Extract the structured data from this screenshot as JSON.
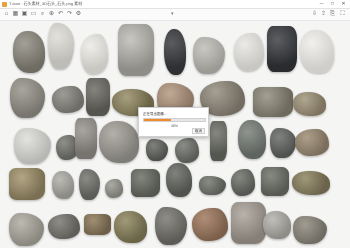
{
  "window": {
    "title": "T-Icon · 石头素材_3D石头_石头.png 素材"
  },
  "toolbar": {
    "icons": [
      "home-icon",
      "grid-icon",
      "image-icon",
      "folder-icon",
      "search-icon",
      "zoom-icon",
      "undo-icon",
      "redo-icon",
      "settings-icon"
    ],
    "right_icons": [
      "download-icon",
      "share-icon",
      "export-icon",
      "fullscreen-icon"
    ]
  },
  "dialog": {
    "message": "正在导出图像…",
    "progress_percent": 45,
    "percent_label": "45%",
    "cancel_label": "取消"
  },
  "colors": {
    "progress_fill": "#f08c2d",
    "canvas_bg": "#f5f5f4"
  }
}
